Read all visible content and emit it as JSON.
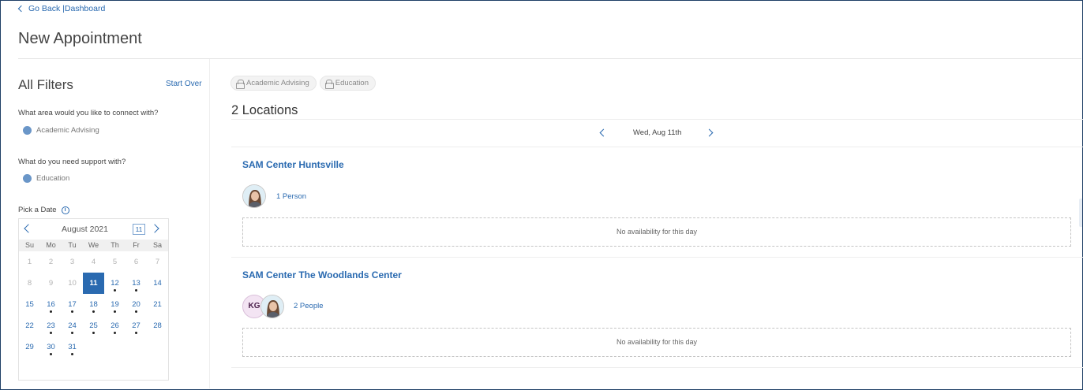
{
  "nav": {
    "go_back": "Go Back |Dashboard"
  },
  "page": {
    "title": "New Appointment"
  },
  "sidebar": {
    "title": "All Filters",
    "start_over": "Start Over",
    "question_area": "What area would you like to connect with?",
    "area_value": "Academic Advising",
    "question_support": "What do you need support with?",
    "support_value": "Education",
    "pick_date": "Pick a Date",
    "info_glyph": "i"
  },
  "calendar": {
    "month_label": "August 2021",
    "today_label": "11",
    "weekdays": [
      "Su",
      "Mo",
      "Tu",
      "We",
      "Th",
      "Fr",
      "Sa"
    ],
    "days": [
      {
        "d": "1",
        "state": "disabled",
        "dot": false
      },
      {
        "d": "2",
        "state": "disabled",
        "dot": false
      },
      {
        "d": "3",
        "state": "disabled",
        "dot": false
      },
      {
        "d": "4",
        "state": "disabled",
        "dot": false
      },
      {
        "d": "5",
        "state": "disabled",
        "dot": false
      },
      {
        "d": "6",
        "state": "disabled",
        "dot": false
      },
      {
        "d": "7",
        "state": "disabled",
        "dot": false
      },
      {
        "d": "8",
        "state": "disabled",
        "dot": false
      },
      {
        "d": "9",
        "state": "disabled",
        "dot": false
      },
      {
        "d": "10",
        "state": "disabled",
        "dot": false
      },
      {
        "d": "11",
        "state": "selected",
        "dot": false
      },
      {
        "d": "12",
        "state": "enabled",
        "dot": true
      },
      {
        "d": "13",
        "state": "enabled",
        "dot": true
      },
      {
        "d": "14",
        "state": "enabled",
        "dot": false
      },
      {
        "d": "15",
        "state": "enabled",
        "dot": false
      },
      {
        "d": "16",
        "state": "enabled",
        "dot": true
      },
      {
        "d": "17",
        "state": "enabled",
        "dot": true
      },
      {
        "d": "18",
        "state": "enabled",
        "dot": true
      },
      {
        "d": "19",
        "state": "enabled",
        "dot": true
      },
      {
        "d": "20",
        "state": "enabled",
        "dot": true
      },
      {
        "d": "21",
        "state": "enabled",
        "dot": false
      },
      {
        "d": "22",
        "state": "enabled",
        "dot": false
      },
      {
        "d": "23",
        "state": "enabled",
        "dot": true
      },
      {
        "d": "24",
        "state": "enabled",
        "dot": true
      },
      {
        "d": "25",
        "state": "enabled",
        "dot": true
      },
      {
        "d": "26",
        "state": "enabled",
        "dot": true
      },
      {
        "d": "27",
        "state": "enabled",
        "dot": true
      },
      {
        "d": "28",
        "state": "enabled",
        "dot": false
      },
      {
        "d": "29",
        "state": "enabled",
        "dot": false
      },
      {
        "d": "30",
        "state": "enabled",
        "dot": true
      },
      {
        "d": "31",
        "state": "enabled",
        "dot": true
      }
    ]
  },
  "chips": [
    {
      "label": "Academic Advising",
      "icon": "lock-icon"
    },
    {
      "label": "Education",
      "icon": "lock-icon"
    }
  ],
  "main": {
    "locations_heading": "2 Locations",
    "selected_date": "Wed, Aug 11th",
    "locations": [
      {
        "name": "SAM Center Huntsville",
        "people_label": "1 Person",
        "availability": "No availability for this day"
      },
      {
        "name": "SAM Center The Woodlands Center",
        "people_label": "2 People",
        "initials": "KG",
        "availability": "No availability for this day"
      }
    ]
  },
  "colors": {
    "accent": "#2a6ab0",
    "filter_dot": "#6a96c8",
    "selected_day_bg": "#2a6ab0",
    "initials_avatar_bg": "#f3e4f3"
  }
}
